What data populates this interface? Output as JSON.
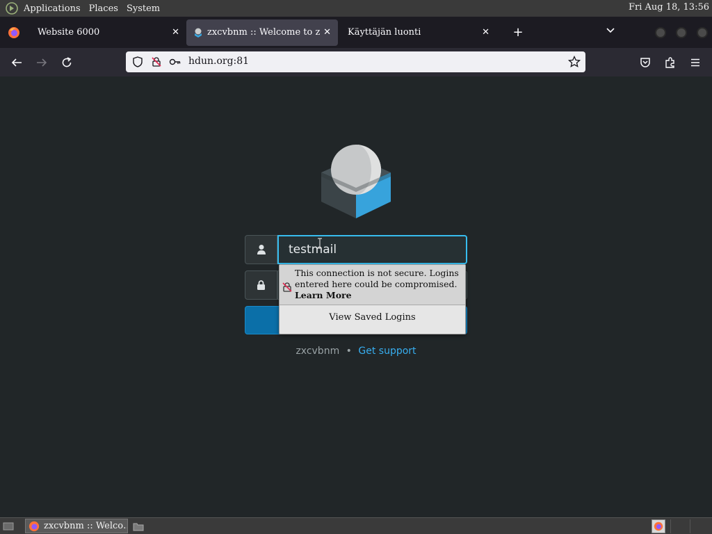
{
  "system_panel": {
    "menus": [
      "Applications",
      "Places",
      "System"
    ],
    "clock": "Fri Aug 18, 13:56"
  },
  "tabs": [
    {
      "title": "Website 6000",
      "active": false
    },
    {
      "title": "zxcvbnm :: Welcome to zxc",
      "active": true
    },
    {
      "title": "Käyttäjän luonti",
      "active": false
    }
  ],
  "navbar": {
    "url": "hdun.org:81"
  },
  "login": {
    "username_value": "testmail",
    "footer_product": "zxcvbnm",
    "footer_separator": "•",
    "footer_link": "Get support"
  },
  "insecure_popup": {
    "message": "This connection is not secure. Logins entered here could be compromised.",
    "learn_more": "Learn More",
    "view_saved": "View Saved Logins"
  },
  "taskbar": {
    "window_title": "zxcvbnm :: Welco…"
  },
  "colors": {
    "page_bg": "#212628",
    "accent": "#37bdef",
    "primary_button": "#0b6fa8"
  }
}
